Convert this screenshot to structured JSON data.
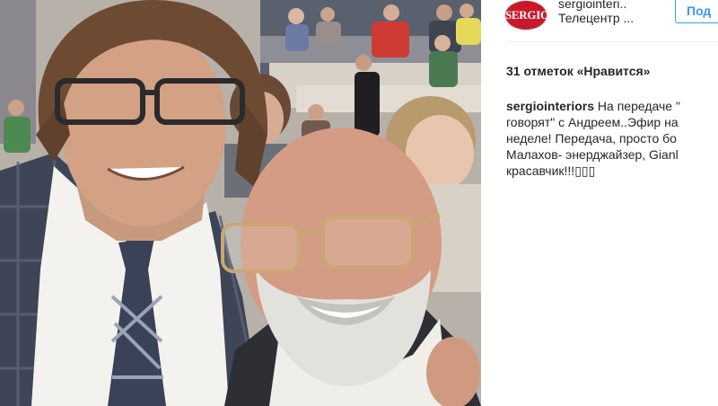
{
  "post": {
    "photo_alt": "",
    "header": {
      "avatar_text": "SERGIO",
      "username": "sergiointeri..",
      "location": "Телецентр ...",
      "follow_label": "Под"
    },
    "likes_text": "31 отметок «Нравится»",
    "caption": {
      "author": "sergiointeriors",
      "line1_text": " На передаче \"",
      "line2": "говорят\" с Андреем..Эфир на",
      "line3": "неделе! Передача, просто бо",
      "line4": "Малахов- энерджайзер, Gianl",
      "line5": "красавчик!!!▯▯▯"
    }
  },
  "colors": {
    "accent": "#3897f0",
    "brand": "#c8192b",
    "text": "#262626"
  }
}
